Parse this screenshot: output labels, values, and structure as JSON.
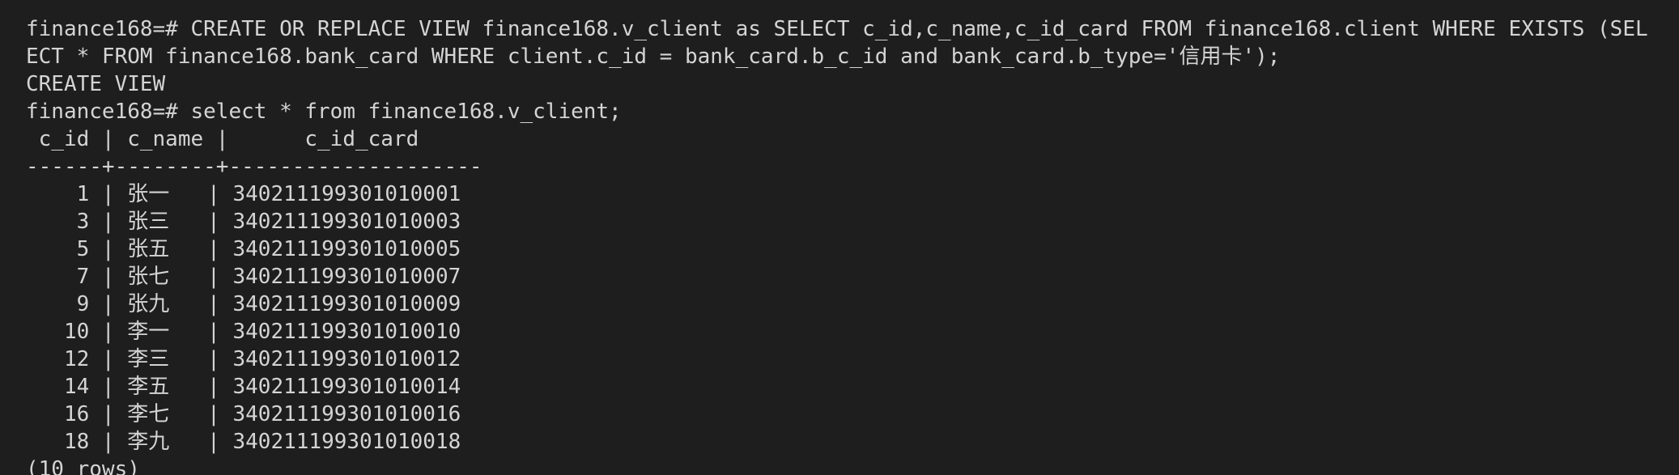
{
  "terminal": {
    "lines": [
      "finance168=# CREATE OR REPLACE VIEW finance168.v_client as SELECT c_id,c_name,c_id_card FROM finance168.client WHERE EXISTS (SEL",
      "ECT * FROM finance168.bank_card WHERE client.c_id = bank_card.b_c_id and bank_card.b_type='信用卡');",
      "CREATE VIEW",
      "finance168=# select * from finance168.v_client;",
      " c_id | c_name |      c_id_card",
      "------+--------+--------------------",
      "    1 | 张一   | 340211199301010001",
      "    3 | 张三   | 340211199301010003",
      "    5 | 张五   | 340211199301010005",
      "    7 | 张七   | 340211199301010007",
      "    9 | 张九   | 340211199301010009",
      "   10 | 李一   | 340211199301010010",
      "   12 | 李三   | 340211199301010012",
      "   14 | 李五   | 340211199301010014",
      "   16 | 李七   | 340211199301010016",
      "   18 | 李九   | 340211199301010018",
      "(10 rows)"
    ]
  }
}
